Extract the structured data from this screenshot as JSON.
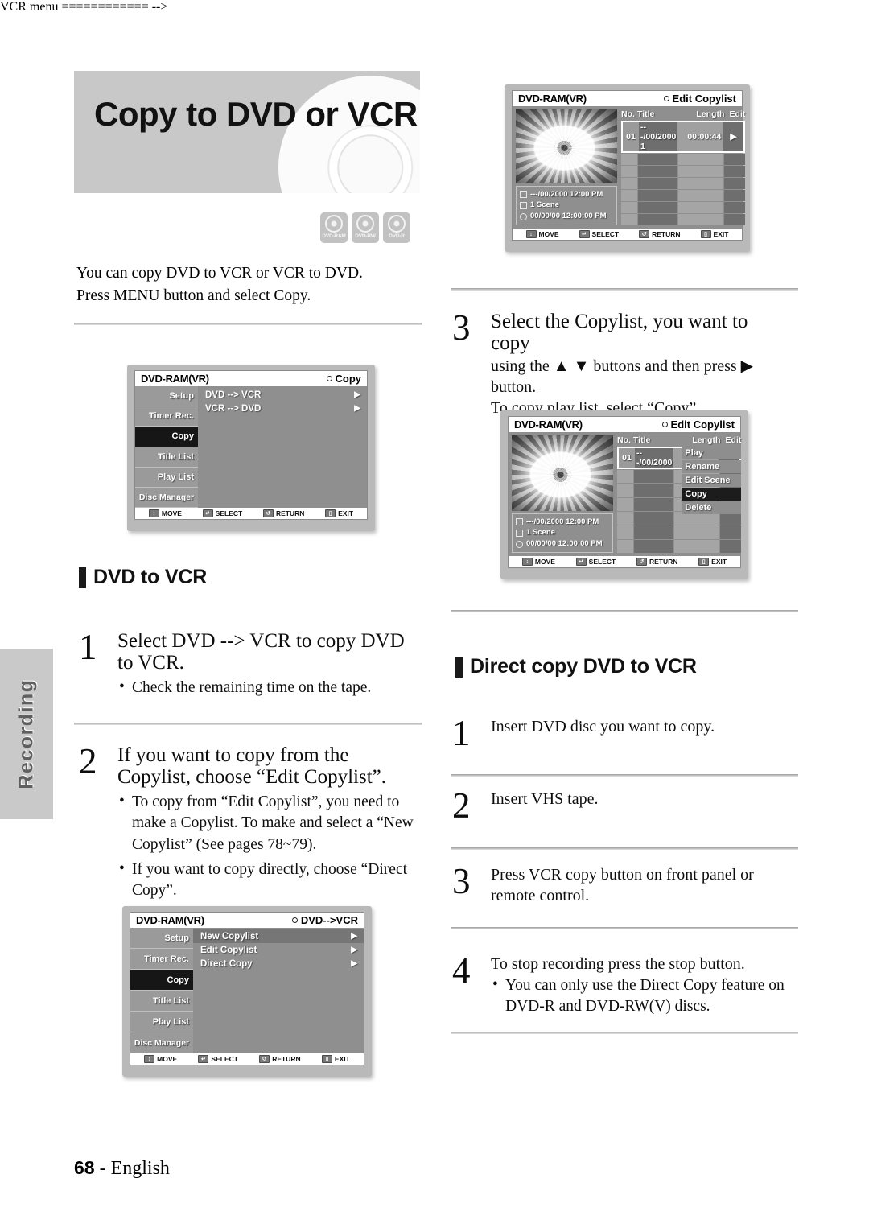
{
  "side_tab": {
    "label": "Recording"
  },
  "banner": {
    "title": "Copy to DVD or VCR"
  },
  "disc_logos": [
    {
      "label": "DVD-RAM"
    },
    {
      "label": "DVD-RW"
    },
    {
      "label": "DVD-R"
    }
  ],
  "intro": {
    "line1": "You can copy DVD to VCR or VCR to DVD.",
    "line2": "Press MENU button and select Copy."
  },
  "screen_copy_menu": {
    "title_left": "DVD-RAM(VR)",
    "title_right": "Copy",
    "sidebar": [
      {
        "label": "Setup",
        "icon": "gear-icon",
        "active": false
      },
      {
        "label": "Timer Rec.",
        "icon": "clock-hand-icon",
        "active": false
      },
      {
        "label": "Copy",
        "icon": "copy-camera-icon",
        "active": true
      },
      {
        "label": "Title List",
        "icon": "title-list-icon",
        "active": false
      },
      {
        "label": "Play List",
        "icon": "play-list-icon",
        "active": false
      },
      {
        "label": "Disc Manager",
        "icon": "disc-manager-icon",
        "active": false
      }
    ],
    "rows": [
      {
        "label": "DVD --> VCR",
        "arrow": "▶",
        "highlight": false
      },
      {
        "label": "VCR --> DVD",
        "arrow": "▶",
        "highlight": false
      }
    ],
    "bottom_bar": [
      {
        "label": "MOVE",
        "icon": "updown-arrows-icon"
      },
      {
        "label": "SELECT",
        "icon": "enter-key-icon"
      },
      {
        "label": "RETURN",
        "icon": "return-arrow-icon"
      },
      {
        "label": "EXIT",
        "icon": "remote-exit-icon"
      }
    ]
  },
  "screen_dvd_to_vcr_menu": {
    "title_left": "DVD-RAM(VR)",
    "title_right": "DVD-->VCR",
    "sidebar": [
      {
        "label": "Setup",
        "icon": "gear-icon",
        "active": false
      },
      {
        "label": "Timer Rec.",
        "icon": "clock-hand-icon",
        "active": false
      },
      {
        "label": "Copy",
        "icon": "copy-camera-icon",
        "active": true
      },
      {
        "label": "Title List",
        "icon": "title-list-icon",
        "active": false
      },
      {
        "label": "Play List",
        "icon": "play-list-icon",
        "active": false
      },
      {
        "label": "Disc Manager",
        "icon": "disc-manager-icon",
        "active": false
      }
    ],
    "rows": [
      {
        "label": "New Copylist",
        "arrow": "▶",
        "highlight": true
      },
      {
        "label": "Edit Copylist",
        "arrow": "▶",
        "highlight": false
      },
      {
        "label": "Direct Copy",
        "arrow": "▶",
        "highlight": false
      }
    ],
    "bottom_bar": [
      {
        "label": "MOVE",
        "icon": "updown-arrows-icon"
      },
      {
        "label": "SELECT",
        "icon": "enter-key-icon"
      },
      {
        "label": "RETURN",
        "icon": "return-arrow-icon"
      },
      {
        "label": "EXIT",
        "icon": "remote-exit-icon"
      }
    ]
  },
  "screen_edit_copylist": {
    "title_left": "DVD-RAM(VR)",
    "title_right": "Edit Copylist",
    "columns": {
      "no": "No.",
      "title": "Title",
      "length": "Length",
      "edit": "Edit"
    },
    "selected_row": {
      "no": "01",
      "title": "---/00/2000 1",
      "length": "00:00:44",
      "edit": "▶"
    },
    "info": {
      "date": "---/00/2000 12:00 PM",
      "scenes": "1 Scene",
      "duration": "00/00/00 12:00:00 PM"
    },
    "bottom_bar": [
      {
        "label": "MOVE",
        "icon": "updown-arrows-icon"
      },
      {
        "label": "SELECT",
        "icon": "enter-key-icon"
      },
      {
        "label": "RETURN",
        "icon": "return-arrow-icon"
      },
      {
        "label": "EXIT",
        "icon": "remote-exit-icon"
      }
    ]
  },
  "screen_edit_copylist_popup": {
    "title_left": "DVD-RAM(VR)",
    "title_right": "Edit Copylist",
    "columns": {
      "no": "No.",
      "title": "Title",
      "length": "Length",
      "edit": "Edit"
    },
    "selected_row": {
      "no": "01",
      "title": "---/00/2000"
    },
    "popup_items": [
      {
        "label": "Play",
        "active": false
      },
      {
        "label": "Rename",
        "active": false
      },
      {
        "label": "Edit Scene",
        "active": false
      },
      {
        "label": "Copy",
        "active": true
      },
      {
        "label": "Delete",
        "active": false
      }
    ],
    "info": {
      "date": "---/00/2000 12:00 PM",
      "scenes": "1 Scene",
      "duration": "00/00/00 12:00:00 PM"
    },
    "bottom_bar": [
      {
        "label": "MOVE",
        "icon": "updown-arrows-icon"
      },
      {
        "label": "SELECT",
        "icon": "enter-key-icon"
      },
      {
        "label": "RETURN",
        "icon": "return-arrow-icon"
      },
      {
        "label": "EXIT",
        "icon": "remote-exit-icon"
      }
    ]
  },
  "section_dvd_to_vcr": {
    "heading": "DVD to VCR"
  },
  "section_direct_copy": {
    "heading": "Direct copy DVD to VCR"
  },
  "steps_left": [
    {
      "num": "1",
      "headline_l1": "Select DVD --> VCR to copy DVD",
      "headline_l2": "to VCR.",
      "bullet1": "Check the remaining time on the tape."
    },
    {
      "num": "2",
      "headline_l1": "If you want to copy from the",
      "headline_l2": "Copylist, choose “Edit Copylist”.",
      "bullet1": "To copy from “Edit Copylist”, you need to make a Copylist. To make and select a “New Copylist” (See pages 78~79).",
      "bullet2": "If you want to copy directly, choose “Direct Copy”."
    }
  ],
  "step_right_3": {
    "num": "3",
    "headline_l1": "Select the Copylist, you want to",
    "headline_l2": "copy",
    "body_l1": "using the ▲ ▼ buttons and then press ▶ button.",
    "body_l2": "To copy play list, select “Copy”."
  },
  "steps_direct": [
    {
      "num": "1",
      "text": "Insert DVD disc you want to copy."
    },
    {
      "num": "2",
      "text": "Insert VHS tape."
    },
    {
      "num": "3",
      "text": "Press VCR copy button on front panel or remote control."
    },
    {
      "num": "4",
      "text": "To stop recording press the stop button.",
      "bullet1": "You can only use the Direct Copy feature on DVD-R and DVD-RW(V) discs."
    }
  ],
  "footer": {
    "page": "68",
    "dash": "-",
    "language": "English"
  }
}
